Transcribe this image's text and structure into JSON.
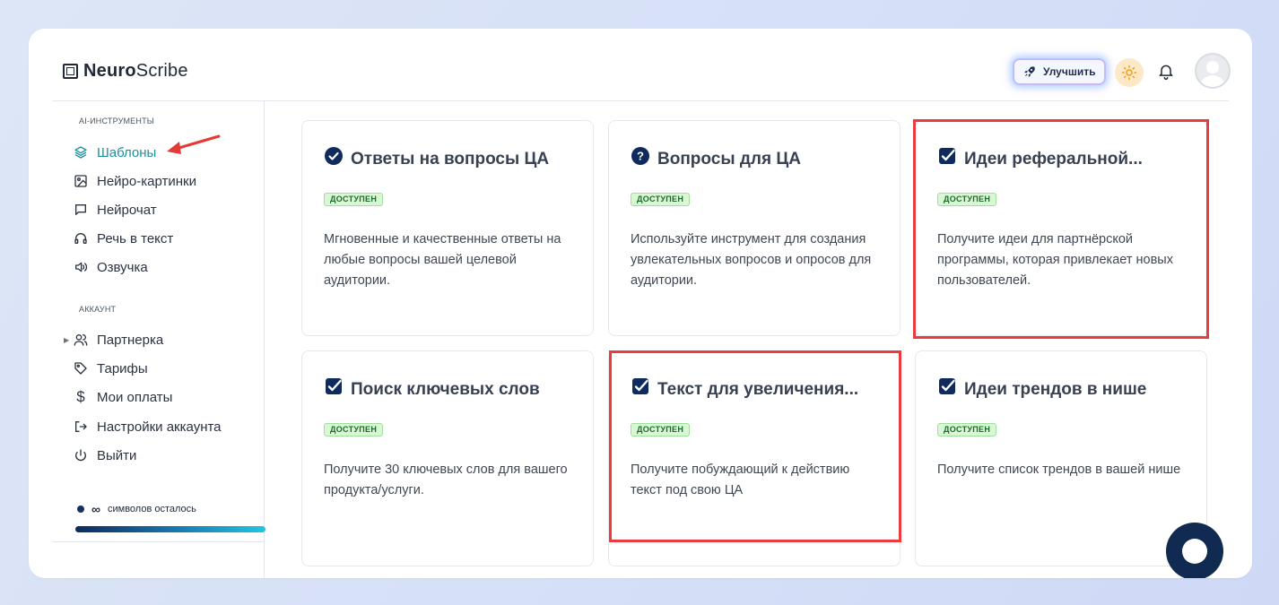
{
  "header": {
    "logo_bold": "Neuro",
    "logo_regular": "Scribe",
    "upgrade_label": "Улучшить"
  },
  "sidebar": {
    "ai_section_title": "AI-ИНСТРУМЕНТЫ",
    "ai_items": [
      {
        "label": "Шаблоны",
        "icon": "layers-icon",
        "active": true
      },
      {
        "label": "Нейро-картинки",
        "icon": "image-icon"
      },
      {
        "label": "Нейрочат",
        "icon": "chat-bubble-icon"
      },
      {
        "label": "Речь в текст",
        "icon": "headphones-icon"
      },
      {
        "label": "Озвучка",
        "icon": "speaker-icon"
      }
    ],
    "account_section_title": "АККАУНТ",
    "account_items": [
      {
        "label": "Партнерка",
        "icon": "users-icon"
      },
      {
        "label": "Тарифы",
        "icon": "tag-icon"
      },
      {
        "label": "Мои оплаты",
        "icon": "dollar-icon"
      },
      {
        "label": "Настройки аккаунта",
        "icon": "logout-arrow-icon"
      },
      {
        "label": "Выйти",
        "icon": "power-icon"
      }
    ],
    "credits_symbol": "∞",
    "credits_label": "символов осталось",
    "credits_progress": 1.0
  },
  "cards": [
    {
      "title": "Ответы на вопросы ЦА",
      "icon": "check-circle-icon",
      "badge": "ДОСТУПЕН",
      "description": "Мгновенные и качественные ответы на любые вопросы вашей целевой аудитории.",
      "highlighted": false
    },
    {
      "title": "Вопросы для ЦА",
      "icon": "question-circle-icon",
      "badge": "ДОСТУПЕН",
      "description": "Используйте инструмент для создания увлекательных вопросов и опросов для аудитории.",
      "highlighted": false
    },
    {
      "title": "Идеи реферальной...",
      "icon": "check-square-icon",
      "badge": "ДОСТУПЕН",
      "description": "Получите идеи для партнёрской программы, которая привлекает новых пользователей.",
      "highlighted": true
    },
    {
      "title": "Поиск ключевых слов",
      "icon": "check-square-icon",
      "badge": "ДОСТУПЕН",
      "description": "Получите 30 ключевых слов для вашего продукта/услуги.",
      "highlighted": false
    },
    {
      "title": "Текст для увеличения...",
      "icon": "check-square-icon",
      "badge": "ДОСТУПЕН",
      "description": "Получите побуждающий к действию текст под свою ЦА",
      "highlighted": true
    },
    {
      "title": "Идеи трендов в нише",
      "icon": "check-square-icon",
      "badge": "ДОСТУПЕН",
      "description": "Получите список трендов в вашей нише",
      "highlighted": false
    }
  ],
  "colors": {
    "accent": "#1e8f9d",
    "brand_dark": "#112a52",
    "badge_bg": "#d9f7d4",
    "highlight": "#ea3b3e",
    "annotation_arrow": "#e53935"
  }
}
